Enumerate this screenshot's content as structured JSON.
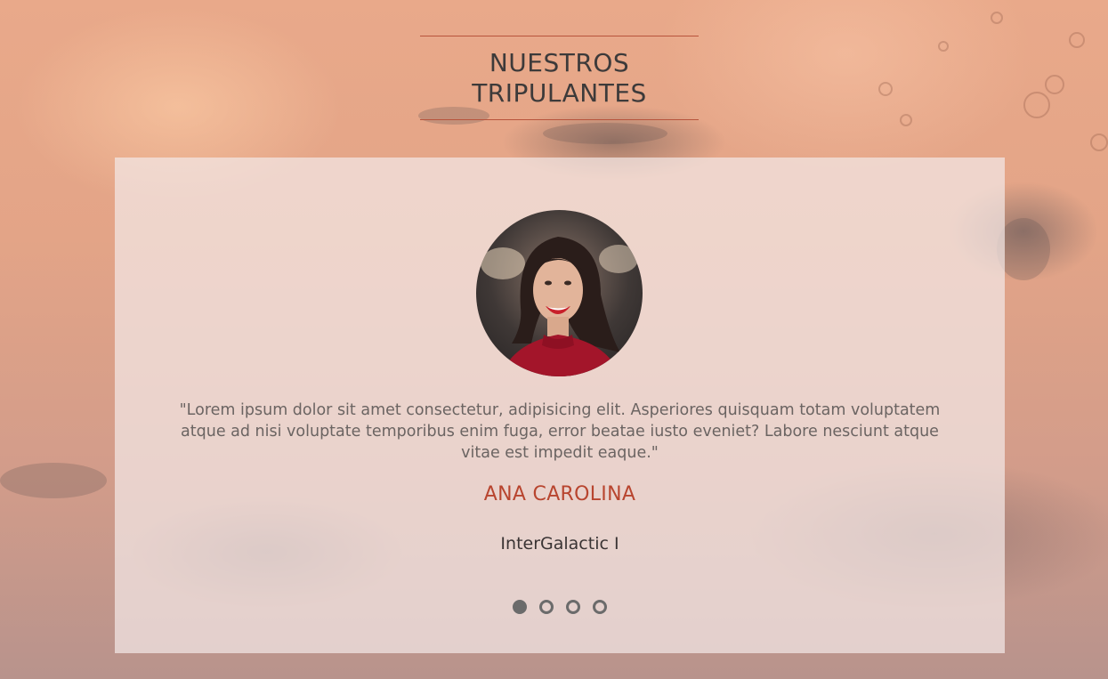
{
  "section": {
    "title": "NUESTROS TRIPULANTES"
  },
  "testimonial": {
    "quote": "\"Lorem ipsum dolor sit amet consectetur, adipisicing elit. Asperiores quisquam totam voluptatem atque ad nisi voluptate temporibus enim fuga, error beatae iusto eveniet? Labore nesciunt atque vitae est impedit eaque.\"",
    "name": "ANA CAROLINA",
    "ship": "InterGalactic I"
  },
  "carousel": {
    "active_index": 0,
    "count": 4
  },
  "colors": {
    "accent": "#b8452f",
    "divider": "#b8543c",
    "dot": "#6b6b6b"
  }
}
